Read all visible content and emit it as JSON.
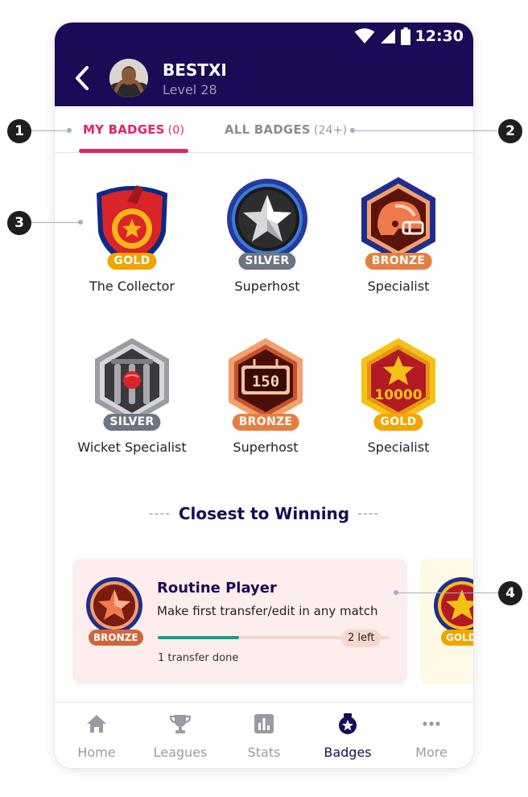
{
  "status_bar": {
    "time": "12:30"
  },
  "header": {
    "username": "BESTXI",
    "level": "Level 28"
  },
  "tabs": [
    {
      "label": "MY BADGES",
      "count": "(0)"
    },
    {
      "label": "ALL BADGES",
      "count": "(24+)"
    }
  ],
  "badges": [
    {
      "tier": "GOLD",
      "name": "The Collector",
      "icon": "medal-shield-icon"
    },
    {
      "tier": "SILVER",
      "name": "Superhost",
      "icon": "star-circle-icon"
    },
    {
      "tier": "BRONZE",
      "name": "Specialist",
      "icon": "helmet-hexagon-icon"
    },
    {
      "tier": "SILVER",
      "name": "Wicket Specialist",
      "icon": "wicket-hexagon-icon"
    },
    {
      "tier": "BRONZE",
      "name": "Superhost",
      "icon": "scoreboard-hexagon-icon",
      "number": "150"
    },
    {
      "tier": "GOLD",
      "name": "Specialist",
      "icon": "star-hexagon-icon",
      "number": "10000"
    }
  ],
  "closest": {
    "title": "Closest to Winning",
    "cards": [
      {
        "title": "Routine Player",
        "description": "Make first transfer/edit in any match",
        "tier": "BRONZE",
        "progress": 0.35,
        "remaining": "2 left",
        "done": "1 transfer done"
      },
      {
        "tier": "GOLD"
      }
    ]
  },
  "bottom_nav": [
    {
      "label": "Home",
      "icon": "home-icon"
    },
    {
      "label": "Leagues",
      "icon": "trophy-icon"
    },
    {
      "label": "Stats",
      "icon": "bar-chart-icon"
    },
    {
      "label": "Badges",
      "icon": "badge-icon",
      "active": true
    },
    {
      "label": "More",
      "icon": "more-dots-icon"
    }
  ],
  "callouts": [
    "1",
    "2",
    "3",
    "4"
  ],
  "colors": {
    "header_bg": "#1b0a55",
    "accent_pink": "#e8215f",
    "gold": "#f0a500",
    "silver": "#6d7483",
    "bronze": "#e57f41",
    "progress": "#12a08a"
  }
}
